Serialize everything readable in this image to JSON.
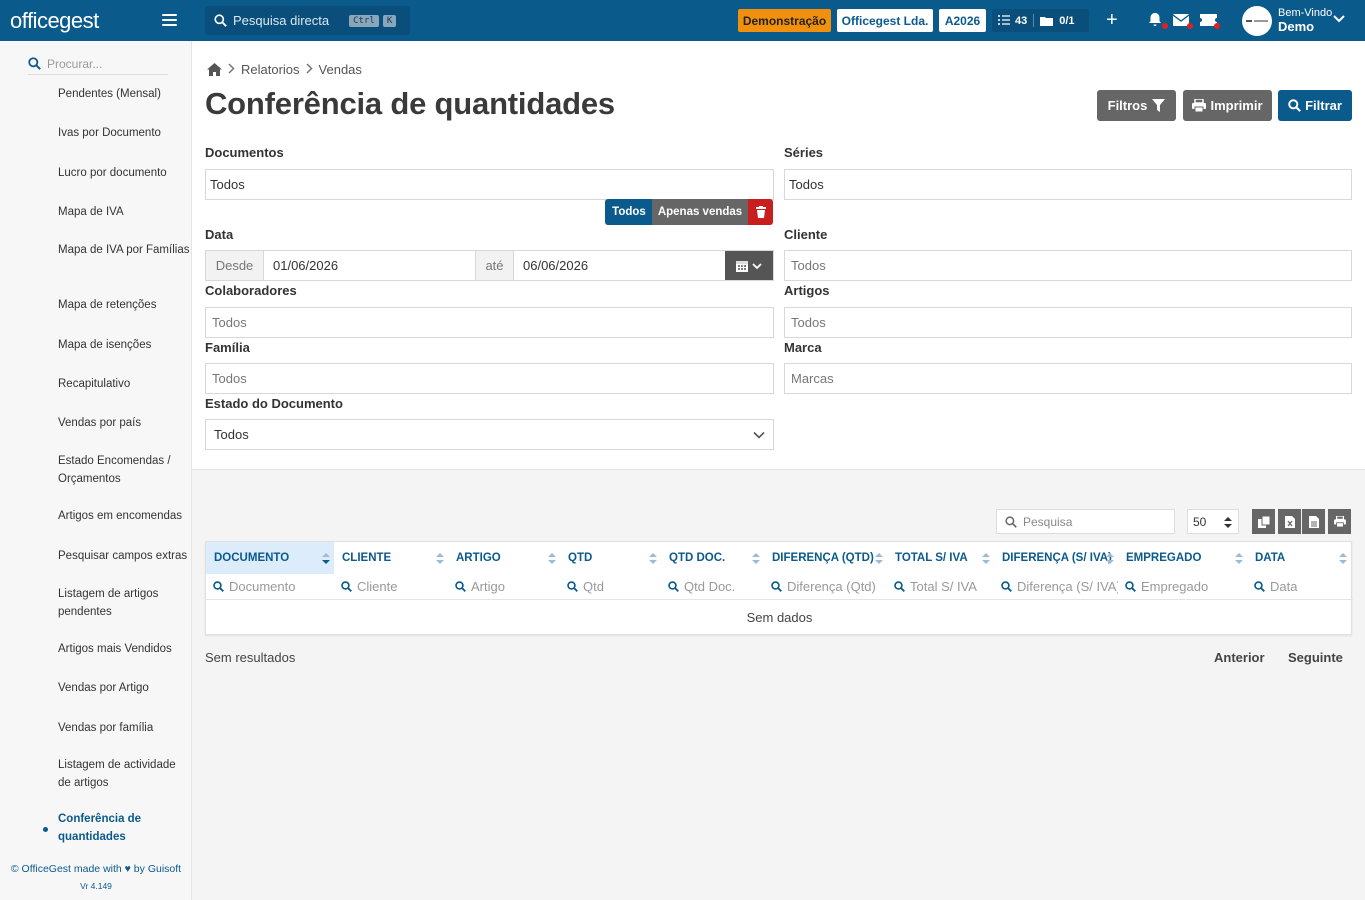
{
  "topbar": {
    "logo": "officegest",
    "search_placeholder": "Pesquisa directa",
    "search_kbd_1": "Ctrl",
    "search_kbd_2": "K",
    "mode_badge": "Demonstração",
    "company": "Officegest Lda.",
    "year": "A2026",
    "tasks_count": "43",
    "docs_count": "0/1",
    "welcome_label": "Bem-Vindo",
    "user_name": "Demo",
    "icons": [
      "menu-icon",
      "search-icon",
      "tasks-icon",
      "folder-icon",
      "plus-icon",
      "bell-icon",
      "mail-icon",
      "ticket-icon",
      "user-dropdown-icon"
    ]
  },
  "sidebar": {
    "search_placeholder": "Procurar...",
    "items": [
      {
        "label": "Pendentes (Mensal)"
      },
      {
        "label": "Ivas por Documento"
      },
      {
        "label": "Lucro por documento"
      },
      {
        "label": "Mapa de IVA"
      },
      {
        "label": "Mapa de IVA por Famílias"
      },
      {
        "label": "Mapa de retenções"
      },
      {
        "label": "Mapa de isenções"
      },
      {
        "label": "Recapitulativo"
      },
      {
        "label": "Vendas por país"
      },
      {
        "label": "Estado Encomendas / Orçamentos"
      },
      {
        "label": "Artigos em encomendas"
      },
      {
        "label": "Pesquisar campos extras"
      },
      {
        "label": "Listagem de artigos pendentes"
      },
      {
        "label": "Artigos mais Vendidos"
      },
      {
        "label": "Vendas por Artigo"
      },
      {
        "label": "Vendas por família"
      },
      {
        "label": "Listagem de actividade de artigos"
      },
      {
        "label": "Conferência de quantidades",
        "active": true
      }
    ],
    "footer": "© OfficeGest made with ♥ by Guisoft",
    "version": "Vr 4.149"
  },
  "breadcrumb": [
    "Relatorios",
    "Vendas"
  ],
  "page_title": "Conferência de quantidades",
  "actions": {
    "filtros": "Filtros",
    "imprimir": "Imprimir",
    "filtrar": "Filtrar"
  },
  "form": {
    "documentos": {
      "label": "Documentos",
      "value": "Todos"
    },
    "series": {
      "label": "Séries",
      "value": "Todos"
    },
    "doc_toggle": {
      "todos": "Todos",
      "apenas_vendas": "Apenas vendas"
    },
    "data": {
      "label": "Data",
      "desde": "Desde",
      "from": "01/06/2026",
      "ate": "até",
      "to": "06/06/2026"
    },
    "cliente": {
      "label": "Cliente",
      "placeholder": "Todos"
    },
    "colaboradores": {
      "label": "Colaboradores",
      "placeholder": "Todos"
    },
    "artigos": {
      "label": "Artigos",
      "placeholder": "Todos"
    },
    "familia": {
      "label": "Família",
      "placeholder": "Todos"
    },
    "marca": {
      "label": "Marca",
      "placeholder": "Marcas"
    },
    "estado": {
      "label": "Estado do Documento",
      "value": "Todos"
    }
  },
  "table": {
    "search_placeholder": "Pesquisa",
    "page_size": "50",
    "columns": [
      {
        "label": "DOCUMENTO",
        "filter": "Documento",
        "sorted": true
      },
      {
        "label": "CLIENTE",
        "filter": "Cliente"
      },
      {
        "label": "ARTIGO",
        "filter": "Artigo"
      },
      {
        "label": "QTD",
        "filter": "Qtd"
      },
      {
        "label": "QTD DOC.",
        "filter": "Qtd Doc."
      },
      {
        "label": "DIFERENÇA (QTD)",
        "filter": "Diferença (Qtd)"
      },
      {
        "label": "TOTAL S/ IVA",
        "filter": "Total S/ IVA"
      },
      {
        "label": "DIFERENÇA (S/ IVA)",
        "filter": "Diferença (S/ IVA)"
      },
      {
        "label": "EMPREGADO",
        "filter": "Empregado"
      },
      {
        "label": "DATA",
        "filter": "Data"
      }
    ],
    "empty": "Sem dados",
    "results": "Sem resultados",
    "prev": "Anterior",
    "next": "Seguinte"
  },
  "colors": {
    "primary": "#0b5a8c",
    "demo": "#f0900c",
    "danger": "#c81e1e",
    "grey_button": "#666666"
  }
}
